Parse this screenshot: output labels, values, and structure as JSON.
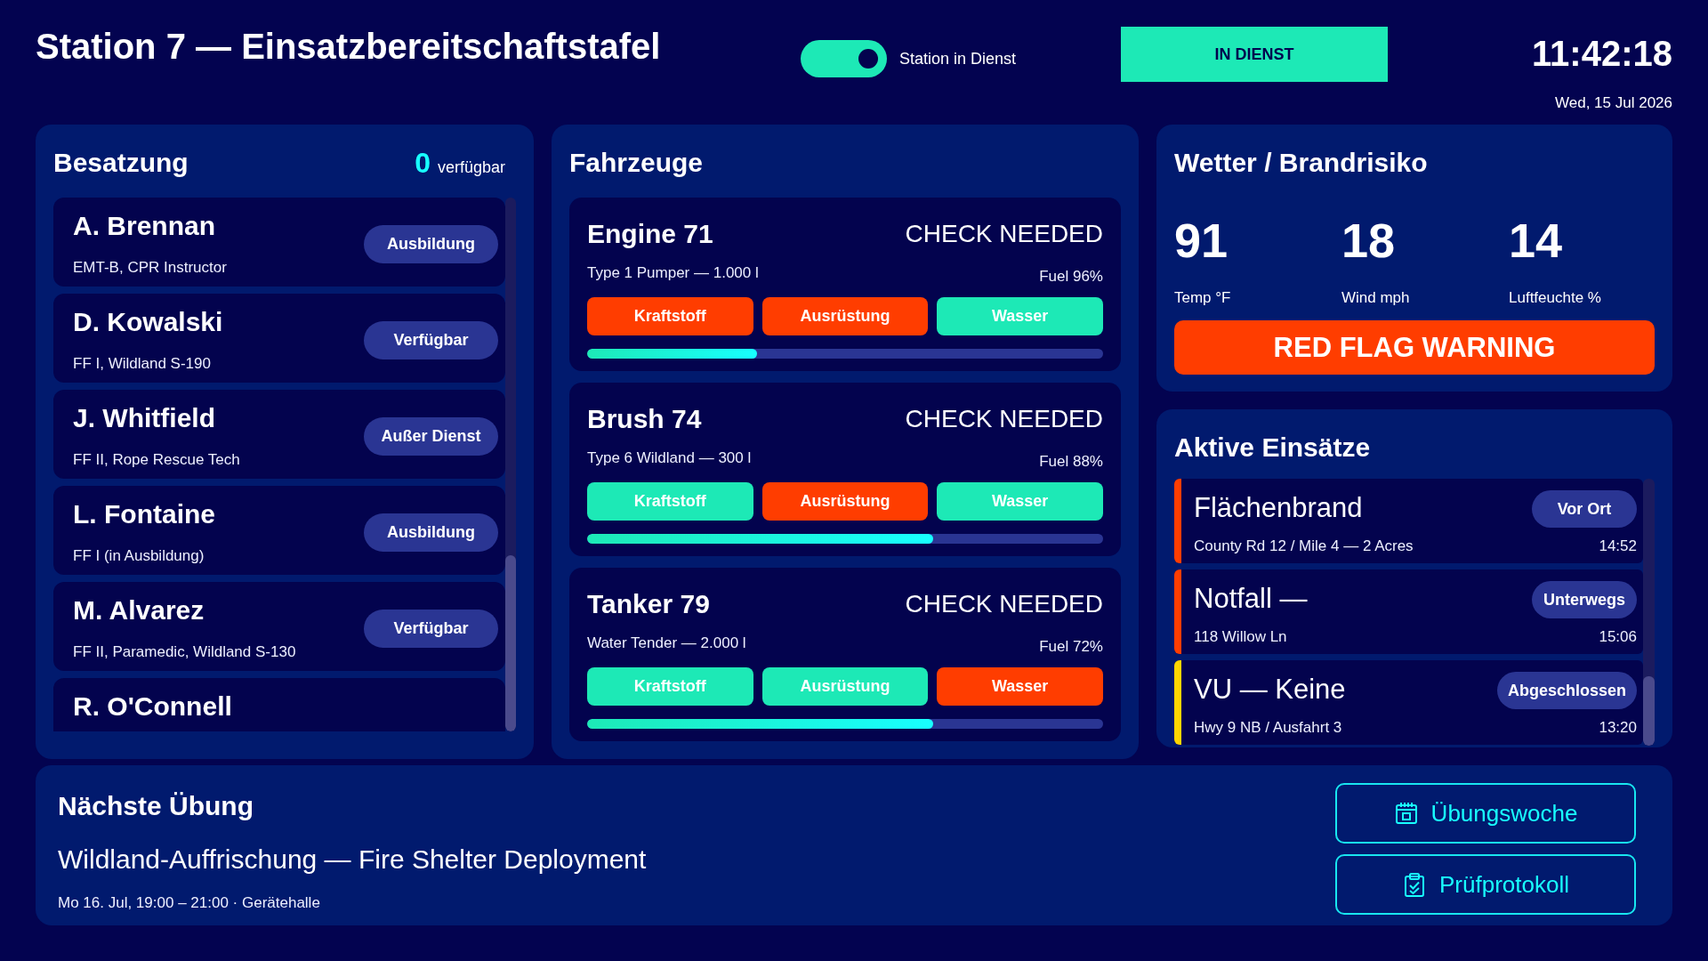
{
  "header": {
    "title": "Station 7 — Einsatzbereitschaftstafel",
    "toggle": {
      "label": "Station in Dienst",
      "on": true
    },
    "status_button": "IN DIENST",
    "clock": "11:42:18",
    "date": "Wed, 15 Jul 2026"
  },
  "crew": {
    "title": "Besatzung",
    "available_count": "0",
    "available_label": "verfügbar",
    "members": [
      {
        "name": "A. Brennan",
        "qualifications": "EMT-B, CPR Instructor",
        "status": "Ausbildung"
      },
      {
        "name": "D. Kowalski",
        "qualifications": "FF I, Wildland S-190",
        "status": "Verfügbar"
      },
      {
        "name": "J. Whitfield",
        "qualifications": "FF II, Rope Rescue Tech",
        "status": "Außer Dienst"
      },
      {
        "name": "L. Fontaine",
        "qualifications": "FF I (in Ausbildung)",
        "status": "Ausbildung"
      },
      {
        "name": "M. Alvarez",
        "qualifications": "FF II, Paramedic, Wildland S-130",
        "status": "Verfügbar"
      },
      {
        "name": "R. O'Connell"
      }
    ]
  },
  "vehicles": {
    "title": "Fahrzeuge",
    "items": [
      {
        "name": "Engine 71",
        "state": "CHECK NEEDED",
        "description": "Type 1 Pumper — 1.000 l",
        "fuel": "Fuel 96%",
        "checks": [
          {
            "label": "Kraftstoff",
            "passed": false
          },
          {
            "label": "Ausrüstung",
            "passed": false
          },
          {
            "label": "Wasser",
            "passed": true
          }
        ],
        "level": 0.33
      },
      {
        "name": "Brush 74",
        "state": "CHECK NEEDED",
        "description": "Type 6 Wildland — 300 l",
        "fuel": "Fuel 88%",
        "checks": [
          {
            "label": "Kraftstoff",
            "passed": true
          },
          {
            "label": "Ausrüstung",
            "passed": false
          },
          {
            "label": "Wasser",
            "passed": true
          }
        ],
        "level": 0.67
      },
      {
        "name": "Tanker 79",
        "state": "CHECK NEEDED",
        "description": "Water Tender — 2.000 l",
        "fuel": "Fuel 72%",
        "checks": [
          {
            "label": "Kraftstoff",
            "passed": true
          },
          {
            "label": "Ausrüstung",
            "passed": true
          },
          {
            "label": "Wasser",
            "passed": false
          }
        ],
        "level": 0.67
      }
    ]
  },
  "weather": {
    "title": "Wetter / Brandrisiko",
    "readings": [
      {
        "value": "91",
        "label": "Temp °F"
      },
      {
        "value": "18",
        "label": "Wind mph"
      },
      {
        "value": "14",
        "label": "Luftfeuchte %"
      }
    ],
    "warning": "RED FLAG WARNING"
  },
  "incidents": {
    "title": "Aktive Einsätze",
    "items": [
      {
        "title": "Flächenbrand",
        "location": "County Rd 12 / Mile 4 — 2 Acres",
        "status": "Vor Ort",
        "time": "14:52",
        "color": "#ff3d00"
      },
      {
        "title": "Notfall —",
        "location": "118 Willow Ln",
        "status": "Unterwegs",
        "time": "15:06",
        "color": "#ff3d00"
      },
      {
        "title": "VU — Keine",
        "location": "Hwy 9 NB / Ausfahrt 3",
        "status": "Abgeschlossen",
        "time": "13:20",
        "color": "#ffd600"
      }
    ]
  },
  "next_drill": {
    "title": "Nächste Übung",
    "name": "Wildland-Auffrischung — Fire Shelter Deployment",
    "details": "Mo 16. Jul, 19:00 – 21:00 · Gerätehalle",
    "buttons": [
      "Übungswoche",
      "Prüfprotokoll"
    ]
  }
}
